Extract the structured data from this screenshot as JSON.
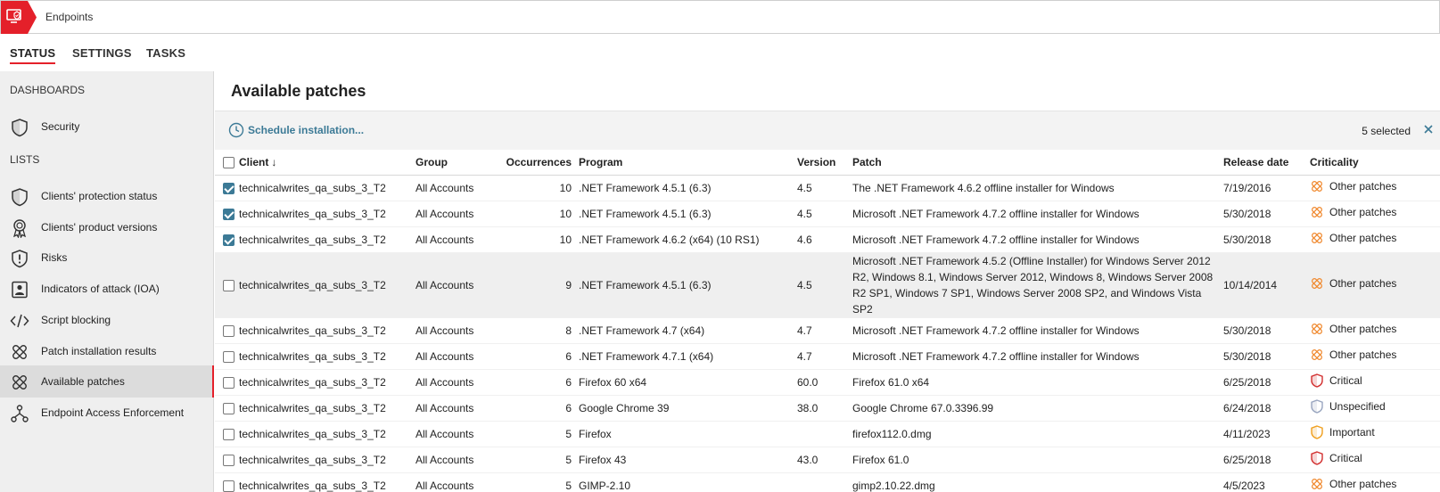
{
  "app": {
    "title": "Endpoints"
  },
  "topnav": [
    "STATUS",
    "SETTINGS",
    "TASKS"
  ],
  "sidebar": {
    "dashboards_label": "DASHBOARDS",
    "lists_label": "LISTS",
    "dashboard_items": [
      {
        "label": "Security",
        "icon": "shield-icon"
      }
    ],
    "list_items": [
      {
        "label": "Clients' protection status",
        "icon": "shield-icon"
      },
      {
        "label": "Clients' product versions",
        "icon": "badge-icon"
      },
      {
        "label": "Risks",
        "icon": "warning-shield-icon"
      },
      {
        "label": "Indicators of attack (IOA)",
        "icon": "person-card-icon"
      },
      {
        "label": "Script blocking",
        "icon": "code-icon"
      },
      {
        "label": "Patch installation results",
        "icon": "patch-icon"
      },
      {
        "label": "Available patches",
        "icon": "patch-icon"
      },
      {
        "label": "Endpoint Access Enforcement",
        "icon": "network-icon"
      }
    ]
  },
  "main": {
    "title": "Available patches",
    "schedule_label": "Schedule installation...",
    "selected_count": "5 selected"
  },
  "table": {
    "headers": {
      "client": "Client",
      "client_sort": "↓",
      "group": "Group",
      "occurrences": "Occurrences",
      "program": "Program",
      "version": "Version",
      "patch": "Patch",
      "release_date": "Release date",
      "criticality": "Criticality"
    },
    "rows": [
      {
        "checked": true,
        "client": "technicalwrites_qa_subs_3_T2",
        "group": "All Accounts",
        "occurrences": "10",
        "program": ".NET Framework 4.5.1 (6.3)",
        "version": "4.5",
        "patch": "The .NET Framework 4.6.2 offline installer for Windows",
        "release_date": "7/19/2016",
        "criticality": "Other patches",
        "level": "other"
      },
      {
        "checked": true,
        "client": "technicalwrites_qa_subs_3_T2",
        "group": "All Accounts",
        "occurrences": "10",
        "program": ".NET Framework 4.5.1 (6.3)",
        "version": "4.5",
        "patch": "Microsoft .NET Framework 4.7.2 offline installer for Windows",
        "release_date": "5/30/2018",
        "criticality": "Other patches",
        "level": "other"
      },
      {
        "checked": true,
        "client": "technicalwrites_qa_subs_3_T2",
        "group": "All Accounts",
        "occurrences": "10",
        "program": ".NET Framework 4.6.2 (x64) (10 RS1)",
        "version": "4.6",
        "patch": "Microsoft .NET Framework 4.7.2 offline installer for Windows",
        "release_date": "5/30/2018",
        "criticality": "Other patches",
        "level": "other"
      },
      {
        "checked": false,
        "client": "technicalwrites_qa_subs_3_T2",
        "group": "All Accounts",
        "occurrences": "9",
        "program": ".NET Framework 4.5.1 (6.3)",
        "version": "4.5",
        "patch": "Microsoft .NET Framework 4.5.2 (Offline Installer) for Windows Server 2012 R2, Windows 8.1, Windows Server 2012, Windows 8, Windows Server 2008 R2 SP1, Windows 7 SP1, Windows Server 2008 SP2, and Windows Vista SP2",
        "release_date": "10/14/2014",
        "criticality": "Other patches",
        "level": "other",
        "tall": true
      },
      {
        "checked": false,
        "client": "technicalwrites_qa_subs_3_T2",
        "group": "All Accounts",
        "occurrences": "8",
        "program": ".NET Framework 4.7 (x64)",
        "version": "4.7",
        "patch": "Microsoft .NET Framework 4.7.2 offline installer for Windows",
        "release_date": "5/30/2018",
        "criticality": "Other patches",
        "level": "other"
      },
      {
        "checked": false,
        "client": "technicalwrites_qa_subs_3_T2",
        "group": "All Accounts",
        "occurrences": "6",
        "program": ".NET Framework 4.7.1 (x64)",
        "version": "4.7",
        "patch": "Microsoft .NET Framework 4.7.2 offline installer for Windows",
        "release_date": "5/30/2018",
        "criticality": "Other patches",
        "level": "other"
      },
      {
        "checked": false,
        "client": "technicalwrites_qa_subs_3_T2",
        "group": "All Accounts",
        "occurrences": "6",
        "program": "Firefox 60 x64",
        "version": "60.0",
        "patch": "Firefox 61.0 x64",
        "release_date": "6/25/2018",
        "criticality": "Critical",
        "level": "critical"
      },
      {
        "checked": false,
        "client": "technicalwrites_qa_subs_3_T2",
        "group": "All Accounts",
        "occurrences": "6",
        "program": "Google Chrome 39",
        "version": "38.0",
        "patch": "Google Chrome 67.0.3396.99",
        "release_date": "6/24/2018",
        "criticality": "Unspecified",
        "level": "unspecified"
      },
      {
        "checked": false,
        "client": "technicalwrites_qa_subs_3_T2",
        "group": "All Accounts",
        "occurrences": "5",
        "program": "Firefox",
        "version": "",
        "patch": "firefox112.0.dmg",
        "release_date": "4/11/2023",
        "criticality": "Important",
        "level": "important"
      },
      {
        "checked": false,
        "client": "technicalwrites_qa_subs_3_T2",
        "group": "All Accounts",
        "occurrences": "5",
        "program": "Firefox 43",
        "version": "43.0",
        "patch": "Firefox 61.0",
        "release_date": "6/25/2018",
        "criticality": "Critical",
        "level": "critical"
      },
      {
        "checked": false,
        "client": "technicalwrites_qa_subs_3_T2",
        "group": "All Accounts",
        "occurrences": "5",
        "program": "GIMP-2.10",
        "version": "",
        "patch": "gimp2.10.22.dmg",
        "release_date": "4/5/2023",
        "criticality": "Other patches",
        "level": "other"
      }
    ]
  },
  "colors": {
    "brand_red": "#e4202a",
    "link_blue": "#3c7a96",
    "other_orange": "#f08a30",
    "critical_red": "#d23030",
    "important_orange": "#f0a020",
    "unspecified_gray": "#9aa6c0"
  }
}
